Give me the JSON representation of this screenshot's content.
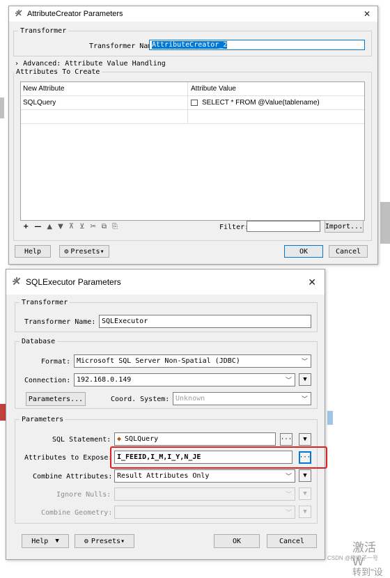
{
  "attr_dialog": {
    "title": "AttributeCreator Parameters",
    "close_glyph": "✕",
    "transformer_group": "Transformer",
    "transformer_name_label": "Transformer Name:",
    "transformer_name_value": "AttributeCreator_2",
    "advanced_label": "Advanced: Attribute Value Handling",
    "attrs_group": "Attributes To Create",
    "table": {
      "columns": [
        "New Attribute",
        "Attribute Value"
      ],
      "rows": [
        {
          "name": "SQLQuery",
          "value": "SELECT * FROM  @Value(tablename)"
        }
      ]
    },
    "toolbar_icons": [
      "+",
      "—",
      "▲",
      "▼",
      "⊼",
      "⊻",
      "✂",
      "⧉",
      "⎘"
    ],
    "filter_label": "Filter:",
    "filter_value": "",
    "import_button": "Import...",
    "help_button": "Help",
    "presets_button": "Presets▾",
    "ok_button": "OK",
    "cancel_button": "Cancel"
  },
  "sql_dialog": {
    "title": "SQLExecutor Parameters",
    "close_glyph": "✕",
    "transformer_group": "Transformer",
    "transformer_name_label": "Transformer Name:",
    "transformer_name_value": "SQLExecutor",
    "database_group": "Database",
    "format_label": "Format:",
    "format_value": "Microsoft SQL Server Non-Spatial (JDBC)",
    "connection_label": "Connection:",
    "connection_value": "192.168.0.149",
    "parameters_button": "Parameters...",
    "coord_system_label": "Coord. System:",
    "coord_system_value": "Unknown",
    "parameters_group": "Parameters",
    "sql_statement_label": "SQL Statement:",
    "sql_statement_value": "SQLQuery",
    "attrs_expose_label": "Attributes to Expose:",
    "attrs_expose_value": "I_FEEID,I_M,I_Y,N_JE",
    "combine_attrs_label": "Combine Attributes:",
    "combine_attrs_value": "Result Attributes Only",
    "ignore_nulls_label": "Ignore Nulls:",
    "combine_geometry_label": "Combine Geometry:",
    "help_button": "Help",
    "presets_button": "Presets▾",
    "ok_button": "OK",
    "cancel_button": "Cancel"
  },
  "watermark": {
    "line1": "激活 W",
    "line2": "转到\"设",
    "csdn": "CSDN @橙橙子一号"
  },
  "colors": {
    "accent": "#0078d7",
    "selection": "#0078d7",
    "callout": "#e02020"
  }
}
